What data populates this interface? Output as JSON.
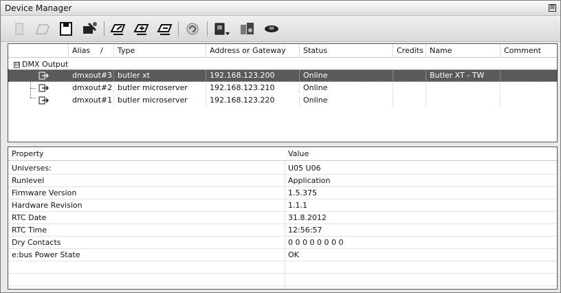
{
  "window": {
    "title": "Device Manager",
    "close_glyph": "⊠"
  },
  "toolbar": {
    "icons": [
      "new-device-icon",
      "open-folder-icon",
      "save-icon",
      "device-tool-icon",
      "device-edit-icon",
      "device-add-icon",
      "device-remove-icon",
      "refresh-icon",
      "device-menu-icon",
      "sound-icon",
      "view-icon"
    ]
  },
  "device_table": {
    "columns": {
      "alias": "Alias",
      "sort": "/",
      "type": "Type",
      "address": "Address or Gateway",
      "status": "Status",
      "credits": "Credits",
      "name": "Name",
      "comment": "Comment"
    },
    "group": {
      "expander": "⊟",
      "label": "DMX Output"
    },
    "rows": [
      {
        "alias": "dmxout#3",
        "type": "butler xt",
        "address": "192.168.123.200",
        "status": "Online",
        "credits": "",
        "name": "Butler XT - TW",
        "comment": ""
      },
      {
        "alias": "dmxout#2",
        "type": "butler microserver",
        "address": "192.168.123.210",
        "status": "Online",
        "credits": "",
        "name": "",
        "comment": ""
      },
      {
        "alias": "dmxout#1",
        "type": "butler microserver",
        "address": "192.168.123.220",
        "status": "Online",
        "credits": "",
        "name": "",
        "comment": ""
      }
    ]
  },
  "properties": {
    "header": {
      "property": "Property",
      "value": "Value"
    },
    "rows": [
      {
        "property": "Universes:",
        "value": "U05 U06"
      },
      {
        "property": "Runlevel",
        "value": "Application"
      },
      {
        "property": "Firmware Version",
        "value": "1.5.375"
      },
      {
        "property": "Hardware Revision",
        "value": "1.1.1"
      },
      {
        "property": "RTC Date",
        "value": "31.8.2012"
      },
      {
        "property": "RTC Time",
        "value": "12:56:57"
      },
      {
        "property": "Dry Contacts",
        "value": "0 0 0 0 0 0 0 0"
      },
      {
        "property": "e:bus Power State",
        "value": "OK"
      }
    ]
  }
}
